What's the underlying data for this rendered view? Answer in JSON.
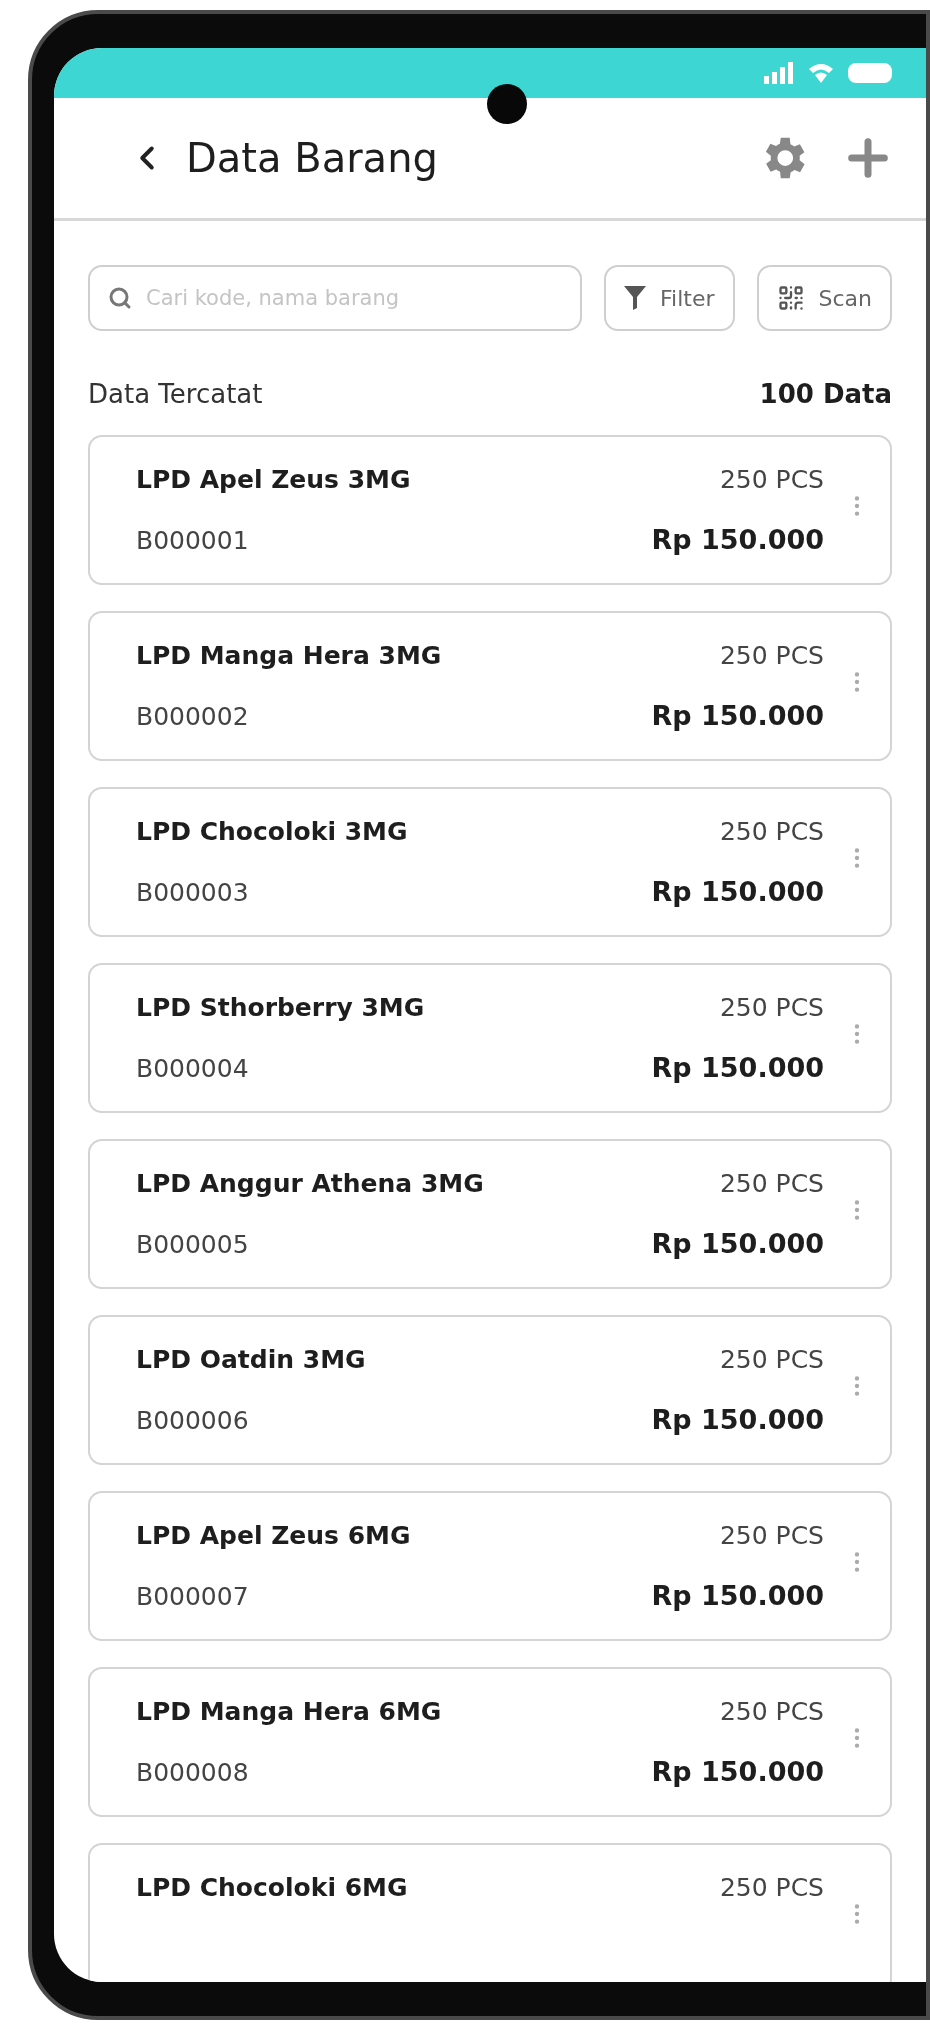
{
  "header": {
    "title": "Data Barang"
  },
  "search": {
    "placeholder": "Cari kode, nama barang"
  },
  "filter_button": {
    "label": "Filter"
  },
  "scan_button": {
    "label": "Scan"
  },
  "summary": {
    "label": "Data Tercatat",
    "count": "100 Data"
  },
  "items": [
    {
      "name": "LPD Apel Zeus 3MG",
      "qty": "250 PCS",
      "code": "B000001",
      "price": "Rp 150.000"
    },
    {
      "name": "LPD Manga Hera 3MG",
      "qty": "250 PCS",
      "code": "B000002",
      "price": "Rp 150.000"
    },
    {
      "name": "LPD Chocoloki 3MG",
      "qty": "250 PCS",
      "code": "B000003",
      "price": "Rp 150.000"
    },
    {
      "name": "LPD Sthorberry 3MG",
      "qty": "250 PCS",
      "code": "B000004",
      "price": "Rp 150.000"
    },
    {
      "name": "LPD Anggur Athena 3MG",
      "qty": "250 PCS",
      "code": "B000005",
      "price": "Rp 150.000"
    },
    {
      "name": "LPD Oatdin 3MG",
      "qty": "250 PCS",
      "code": "B000006",
      "price": "Rp 150.000"
    },
    {
      "name": "LPD Apel Zeus 6MG",
      "qty": "250 PCS",
      "code": "B000007",
      "price": "Rp 150.000"
    },
    {
      "name": "LPD Manga Hera 6MG",
      "qty": "250 PCS",
      "code": "B000008",
      "price": "Rp 150.000"
    },
    {
      "name": "LPD Chocoloki 6MG",
      "qty": "250 PCS"
    }
  ]
}
